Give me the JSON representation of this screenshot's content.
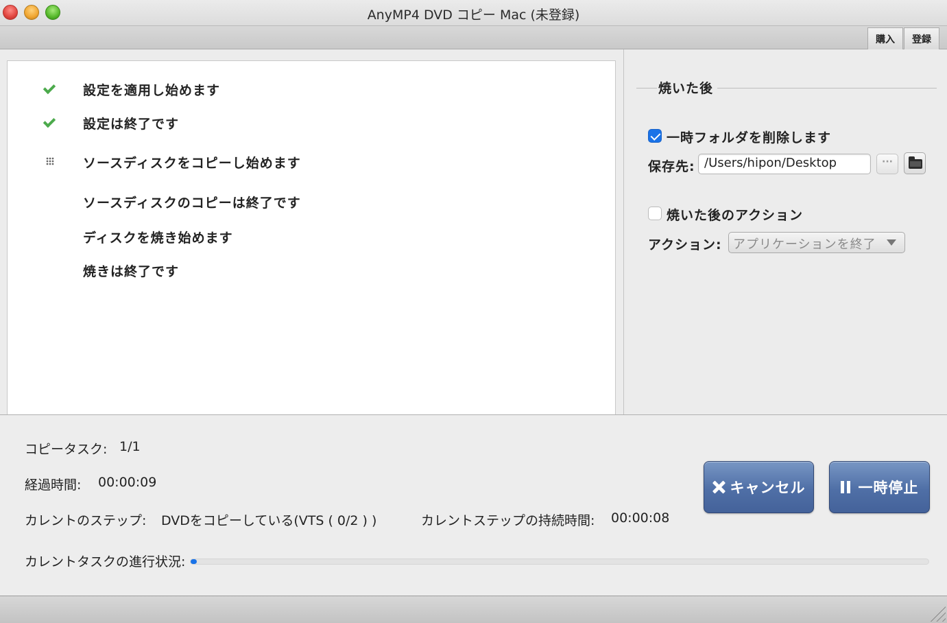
{
  "window": {
    "title": "AnyMP4 DVD コピー Mac (未登録)"
  },
  "toolbar": {
    "buy_label": "購入",
    "register_label": "登録"
  },
  "log": {
    "items": [
      {
        "text": "設定を適用し始めます",
        "status": "done",
        "icon": "check-icon"
      },
      {
        "text": "設定は終了です",
        "status": "done",
        "icon": "check-icon"
      },
      {
        "text": "ソースディスクをコピーし始めます",
        "status": "in-progress",
        "icon": "grid-icon"
      },
      {
        "text": "ソースディスクのコピーは終了です",
        "status": "pending",
        "icon": ""
      },
      {
        "text": "ディスクを焼き始めます",
        "status": "pending",
        "icon": ""
      },
      {
        "text": "焼きは終了です",
        "status": "pending",
        "icon": ""
      }
    ]
  },
  "after_burn": {
    "group_title": "焼いた後",
    "delete_temp_label": "一時フォルダを削除します",
    "delete_temp_checked": true,
    "save_to_label": "保存先:",
    "save_path": "/Users/hipon/Desktop",
    "browse_label": "···",
    "action_after_label": "焼いた後のアクション",
    "action_after_checked": false,
    "action_label": "アクション:",
    "action_value": "アプリケーションを終了"
  },
  "status": {
    "task_label": "コピータスク:",
    "task_value": "1/1",
    "elapsed_label": "経過時間:",
    "elapsed_value": "00:00:09",
    "current_step_label": "カレントのステップ:",
    "current_step_value": "DVDをコピーしている(VTS ( 0/2 ) )",
    "step_duration_label": "カレントステップの持続時間:",
    "step_duration_value": "00:00:08",
    "progress_label": "カレントタスクの進行状況:",
    "progress_fraction": 0.0
  },
  "buttons": {
    "cancel_label": "キャンセル",
    "pause_label": "一時停止"
  },
  "colors": {
    "accent": "#1a73e8",
    "check": "#4caa4c",
    "button_blue": "#4f6fa6"
  }
}
